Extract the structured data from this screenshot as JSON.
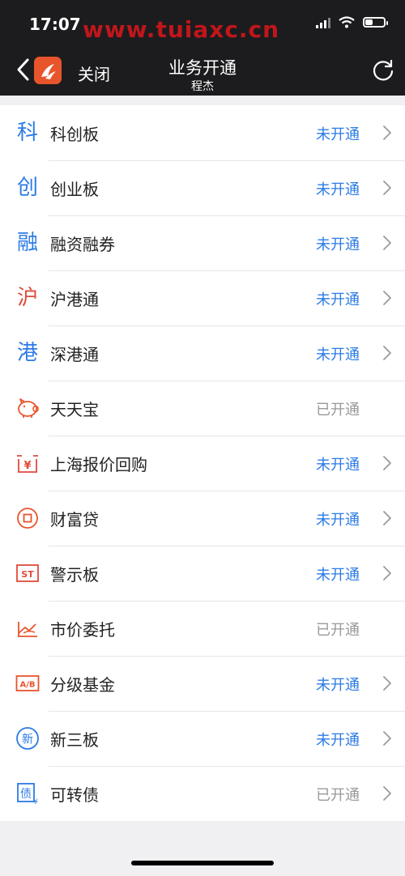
{
  "status_bar": {
    "time": "17:07",
    "watermark": "www.tuiaxc.cn"
  },
  "nav": {
    "close_label": "关闭",
    "title": "业务开通",
    "subtitle": "程杰"
  },
  "colors": {
    "blue": "#2c7be5",
    "red": "#e04a3a",
    "orange": "#e8542b",
    "gray": "#999999"
  },
  "items": [
    {
      "icon": "科",
      "icon_name": "kechuang-icon",
      "icon_color": "#2c7be5",
      "label": "科创板",
      "status": "未开通",
      "opened": false,
      "chevron": true
    },
    {
      "icon": "创",
      "icon_name": "chuangye-icon",
      "icon_color": "#2c7be5",
      "label": "创业板",
      "status": "未开通",
      "opened": false,
      "chevron": true
    },
    {
      "icon": "融",
      "icon_name": "margin-trading-icon",
      "icon_color": "#2c7be5",
      "label": "融资融券",
      "status": "未开通",
      "opened": false,
      "chevron": true
    },
    {
      "icon": "沪",
      "icon_name": "shanghai-connect-icon",
      "icon_color": "#e04a3a",
      "label": "沪港通",
      "status": "未开通",
      "opened": false,
      "chevron": true
    },
    {
      "icon": "港",
      "icon_name": "shenzhen-connect-icon",
      "icon_color": "#2c7be5",
      "label": "深港通",
      "status": "未开通",
      "opened": false,
      "chevron": true
    },
    {
      "icon": "",
      "icon_name": "piggy-bank-icon",
      "icon_color": "#e8542b",
      "label": "天天宝",
      "status": "已开通",
      "opened": true,
      "chevron": false
    },
    {
      "icon": "¥",
      "icon_name": "repo-yen-icon",
      "icon_color": "#e04a3a",
      "label": "上海报价回购",
      "status": "未开通",
      "opened": false,
      "chevron": true
    },
    {
      "icon": "",
      "icon_name": "coin-icon",
      "icon_color": "#e8542b",
      "label": "财富贷",
      "status": "未开通",
      "opened": false,
      "chevron": true
    },
    {
      "icon": "ST",
      "icon_name": "st-warning-icon",
      "icon_color": "#e04a3a",
      "label": "警示板",
      "status": "未开通",
      "opened": false,
      "chevron": true
    },
    {
      "icon": "",
      "icon_name": "market-order-icon",
      "icon_color": "#e8542b",
      "label": "市价委托",
      "status": "已开通",
      "opened": true,
      "chevron": false
    },
    {
      "icon": "A/B",
      "icon_name": "graded-fund-icon",
      "icon_color": "#e8542b",
      "label": "分级基金",
      "status": "未开通",
      "opened": false,
      "chevron": true
    },
    {
      "icon": "新",
      "icon_name": "neeq-icon",
      "icon_color": "#2c7be5",
      "label": "新三板",
      "status": "未开通",
      "opened": false,
      "chevron": true
    },
    {
      "icon": "债",
      "icon_name": "convertible-bond-icon",
      "icon_color": "#2c7be5",
      "label": "可转债",
      "status": "已开通",
      "opened": true,
      "chevron": true
    }
  ]
}
